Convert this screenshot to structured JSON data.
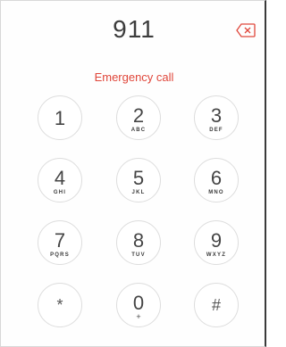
{
  "display": {
    "number": "911",
    "backspace_icon": "backspace-icon"
  },
  "status": {
    "label": "Emergency call",
    "accent_color": "#e0473b"
  },
  "keypad": {
    "keys": [
      {
        "digit": "1",
        "letters": ""
      },
      {
        "digit": "2",
        "letters": "ABC"
      },
      {
        "digit": "3",
        "letters": "DEF"
      },
      {
        "digit": "4",
        "letters": "GHI"
      },
      {
        "digit": "5",
        "letters": "JKL"
      },
      {
        "digit": "6",
        "letters": "MNO"
      },
      {
        "digit": "7",
        "letters": "PQRS"
      },
      {
        "digit": "8",
        "letters": "TUV"
      },
      {
        "digit": "9",
        "letters": "WXYZ"
      },
      {
        "digit": "*",
        "letters": ""
      },
      {
        "digit": "0",
        "letters": "+"
      },
      {
        "digit": "#",
        "letters": ""
      }
    ]
  }
}
